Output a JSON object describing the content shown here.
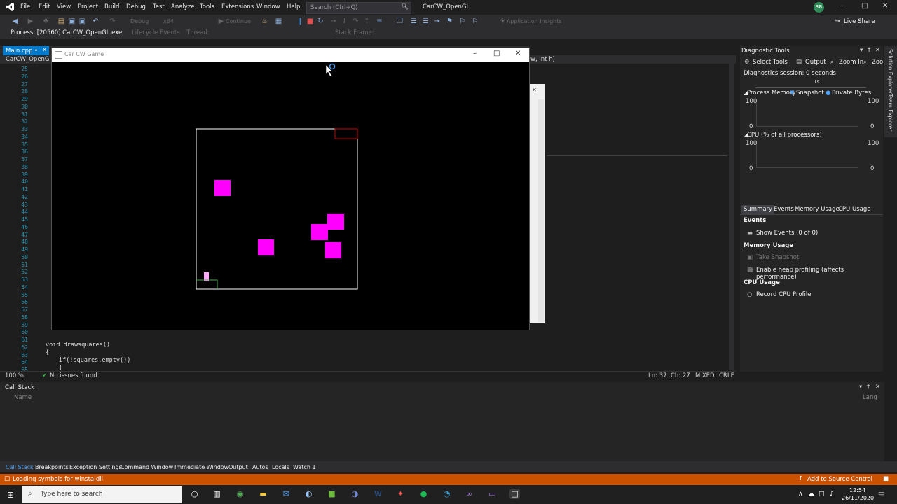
{
  "menu": [
    "File",
    "Edit",
    "View",
    "Project",
    "Build",
    "Debug",
    "Test",
    "Analyze",
    "Tools",
    "Extensions",
    "Window",
    "Help"
  ],
  "search_placeholder": "Search (Ctrl+Q)",
  "solution_name": "CarCW_OpenGL",
  "user_initials": "RB",
  "live_share": "Live Share",
  "toolbar": {
    "config": "Debug",
    "platform": "x64",
    "continue": "Continue",
    "app_insights": "Application Insights"
  },
  "debugbar": {
    "process": "Process: [20560] CarCW_OpenGL.exe",
    "lifecycle": "Lifecycle Events",
    "thread": "Thread:",
    "stack_frame": "Stack Frame:"
  },
  "doc_tab": "Main.cpp",
  "nav_project": "CarCW_OpenG",
  "nav_member": "w, int h)",
  "editor": {
    "lines": [
      "25",
      "26",
      "27",
      "28",
      "29",
      "30",
      "31",
      "32",
      "33",
      "34",
      "35",
      "36",
      "37",
      "38",
      "39",
      "40",
      "41",
      "42",
      "43",
      "44",
      "45",
      "46",
      "47",
      "48",
      "49",
      "50",
      "51",
      "52",
      "53",
      "54",
      "55",
      "56",
      "57",
      "58",
      "59",
      "60",
      "61",
      "62",
      "63",
      "64",
      "65"
    ],
    "code_62": "void drawsquares()",
    "code_63": "{",
    "code_64": "if(!squares.empty())",
    "code_65": "{",
    "zoom": "100 %",
    "issues": "No issues found",
    "ln": "Ln: 37",
    "ch": "Ch: 27",
    "mixed": "MIXED",
    "crlf": "CRLF"
  },
  "game": {
    "title": "Car CW Game",
    "squares_color": "#ff00ff"
  },
  "diagnostics": {
    "title": "Diagnostic Tools",
    "select_tools": "Select Tools",
    "output": "Output",
    "zoom_in": "Zoom In",
    "zoom_out": "Zoo",
    "session": "Diagnostics session: 0 seconds",
    "timeline_label": "1s",
    "process_memory": "Process Memory",
    "snapshot": "Snapshot",
    "private_bytes": "Private Bytes",
    "mem_max": "100",
    "mem_min": "0",
    "cpu_label": "CPU (% of all processors)",
    "cpu_max": "100",
    "cpu_min": "0",
    "tabs": [
      "Summary",
      "Events",
      "Memory Usage",
      "CPU Usage"
    ],
    "events_header": "Events",
    "show_events": "Show Events (0 of 0)",
    "memory_header": "Memory Usage",
    "take_snapshot": "Take Snapshot",
    "heap_profiling": "Enable heap profiling (affects performance)",
    "cpu_header": "CPU Usage",
    "record_cpu": "Record CPU Profile"
  },
  "side_tabs": [
    "Solution Explorer",
    "Team Explorer"
  ],
  "callstack": {
    "title": "Call Stack",
    "col_name": "Name",
    "col_lang": "Lang"
  },
  "bottom_tabs": [
    "Call Stack",
    "Breakpoints",
    "Exception Settings",
    "Command Window",
    "Immediate Window",
    "Output",
    "Autos",
    "Locals",
    "Watch 1"
  ],
  "status": {
    "message": "Loading symbols for winsta.dll",
    "source_control": "Add to Source Control"
  },
  "taskbar": {
    "search": "Type here to search",
    "time": "12:54",
    "date": "26/11/2020"
  },
  "colors": {
    "accent": "#007acc",
    "statusbar": "#ca5100",
    "game_bg": "#000000",
    "square": "#ff00ff"
  }
}
